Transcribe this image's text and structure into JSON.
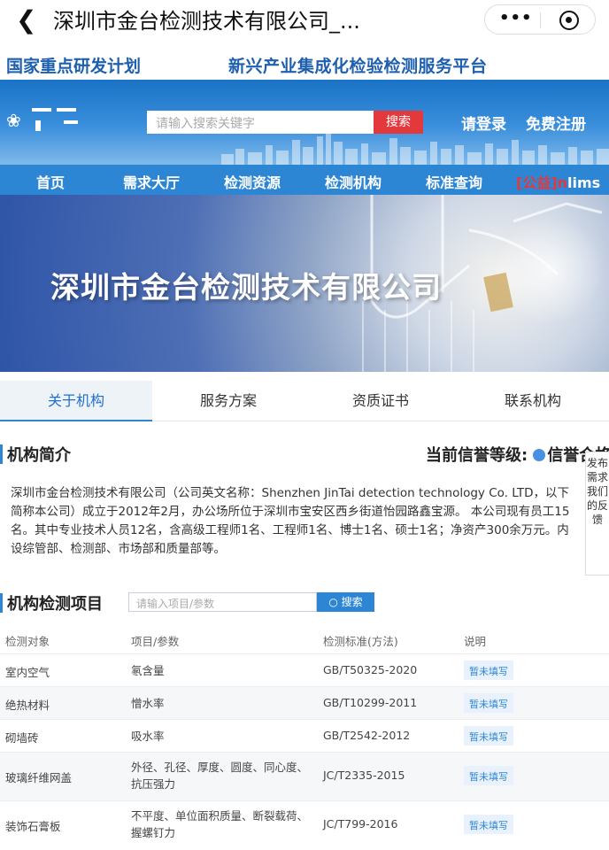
{
  "window": {
    "title": "深圳市金台检测技术有限公司_...",
    "more_icon": "•••"
  },
  "slogan": {
    "left": "国家重点研发计划",
    "right": "新兴产业集成化检验检测服务平台"
  },
  "header": {
    "search_placeholder": "请输入搜索关键字",
    "search_button": "搜索",
    "login": "请登录",
    "register": "免费注册"
  },
  "nav": {
    "items": [
      "首页",
      "需求大厅",
      "检测资源",
      "检测机构",
      "标准查询"
    ],
    "last_red": "[公益]",
    "last_mid": "n",
    "last_white": "lims"
  },
  "banner": {
    "title": "深圳市金台检测技术有限公司"
  },
  "tabs": [
    "关于机构",
    "服务方案",
    "资质证书",
    "联系机构"
  ],
  "intro": {
    "heading": "机构简介",
    "credit_label": "当前信誉等级:",
    "credit_value": "信誉合格",
    "text": "深圳市金台检测技术有限公司（公司英文名称：Shenzhen JinTai detection technology Co. LTD，以下简称本公司）成立于2012年2月，办公场所位于深圳市宝安区西乡街道怡园路鑫宝源。 本公司现有员工15名。其中专业技术人员12名，含高级工程师1名、工程师1名、博士1名、硕士1名；净资产300余万元。内设综管部、检测部、市场部和质量部等。"
  },
  "feedback": {
    "text": "发布需求我们的反馈"
  },
  "items": {
    "heading": "机构检测项目",
    "search_placeholder": "请输入项目/参数",
    "search_button": "搜索",
    "columns": [
      "检测对象",
      "项目/参数",
      "检测标准(方法)",
      "说明"
    ],
    "rows": [
      {
        "object": "室内空气",
        "param": "氡含量",
        "standard": "GB/T50325-2020",
        "note": "暂未填写"
      },
      {
        "object": "绝热材料",
        "param": "憎水率",
        "standard": "GB/T10299-2011",
        "note": "暂未填写"
      },
      {
        "object": "砌墙砖",
        "param": "吸水率",
        "standard": "GB/T2542-2012",
        "note": "暂未填写"
      },
      {
        "object": "玻璃纤维网盖",
        "param": "外径、孔径、厚度、圆度、同心度、抗压强力",
        "standard": "JC/T2335-2015",
        "note": "暂未填写"
      },
      {
        "object": "装饰石膏板",
        "param": "不平度、单位面积质量、断裂载荷、握螺钉力",
        "standard": "JC/T799-2016",
        "note": "暂未填写"
      }
    ]
  }
}
